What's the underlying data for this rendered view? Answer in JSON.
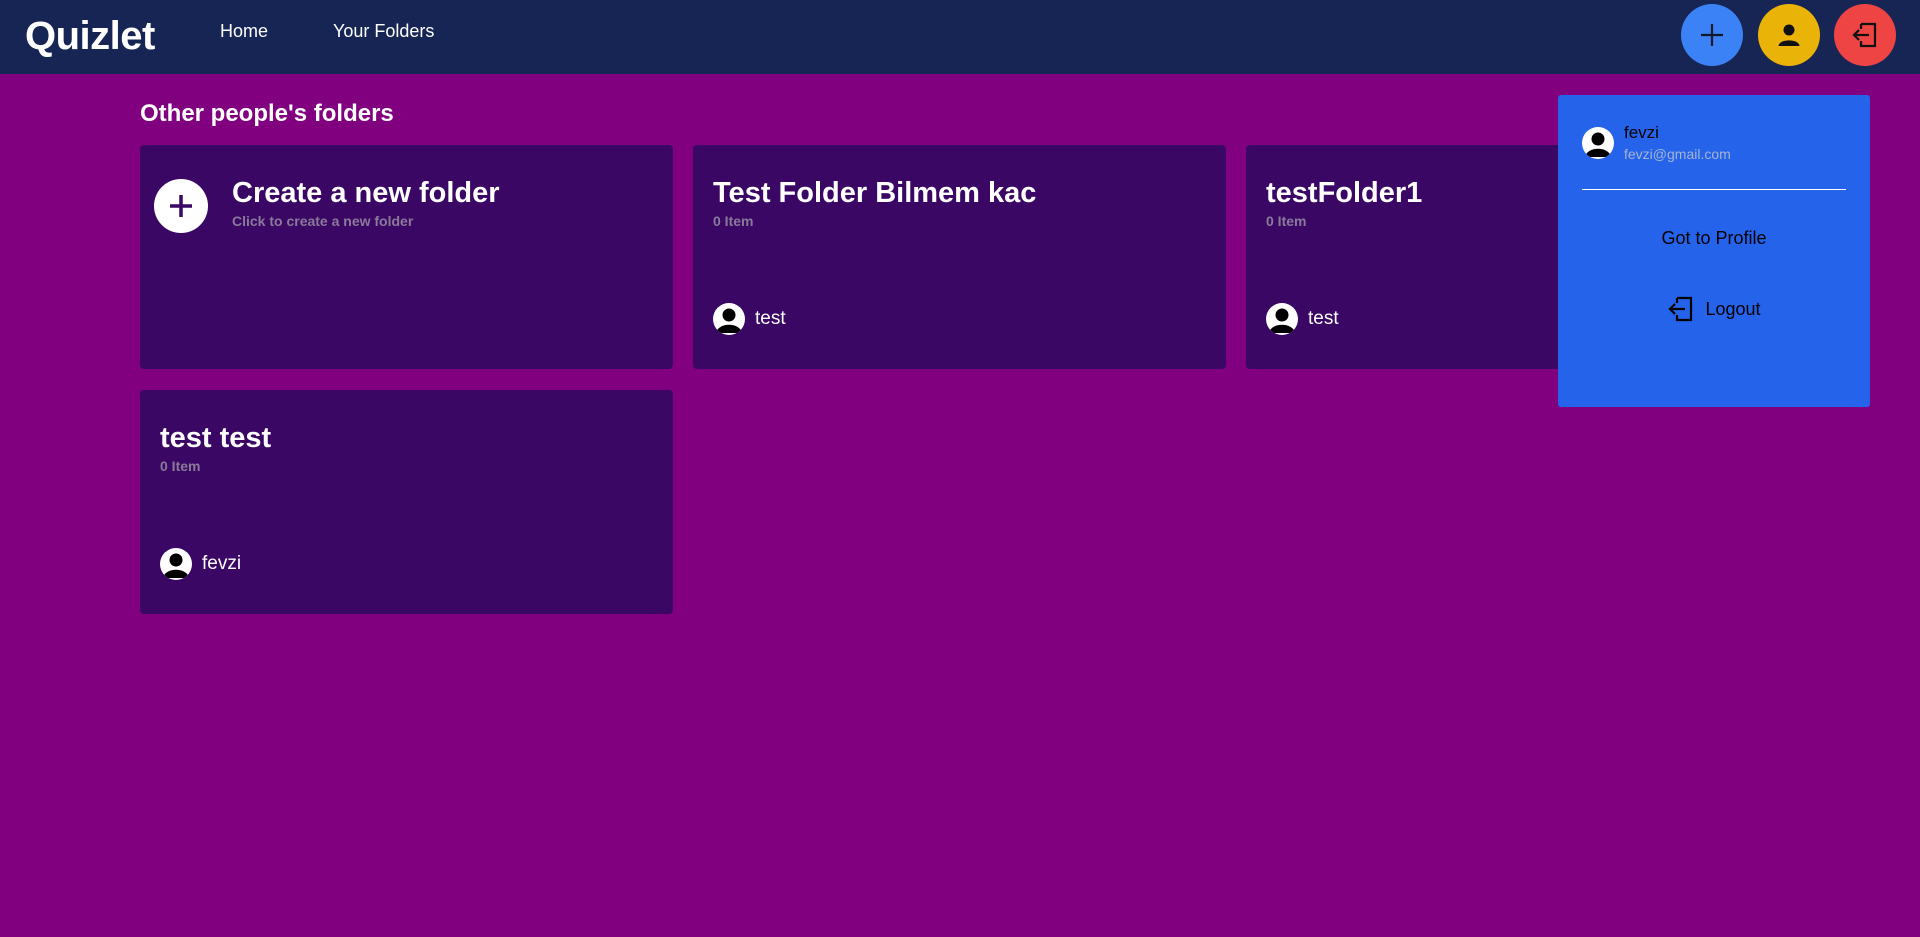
{
  "navbar": {
    "brand": "Quizlet",
    "links": {
      "home": "Home",
      "folders": "Your Folders"
    },
    "buttons": {
      "add_icon": "plus-icon",
      "user_icon": "user-icon",
      "logout_icon": "logout-icon"
    }
  },
  "colors": {
    "page_bg": "#800080",
    "navbar_bg": "#172554",
    "card_bg": "#3b0764",
    "add_btn": "#3b82f6",
    "user_btn": "#eab308",
    "logout_btn": "#ef4444",
    "dropdown_bg": "#2563eb"
  },
  "main": {
    "section_title": "Other people's folders",
    "create_card": {
      "title": "Create a new folder",
      "subtitle": "Click to create a new folder",
      "icon": "plus-icon"
    },
    "folders": [
      {
        "title": "Test Folder Bilmem kac",
        "items": "0 Item",
        "owner": "test"
      },
      {
        "title": "testFolder1",
        "items": "0 Item",
        "owner": "test"
      },
      {
        "title": "test test",
        "items": "0 Item",
        "owner": "fevzi"
      }
    ]
  },
  "dropdown": {
    "username": "fevzi",
    "email": "fevzi@gmail.com",
    "profile_label": "Got to Profile",
    "logout_label": "Logout"
  }
}
